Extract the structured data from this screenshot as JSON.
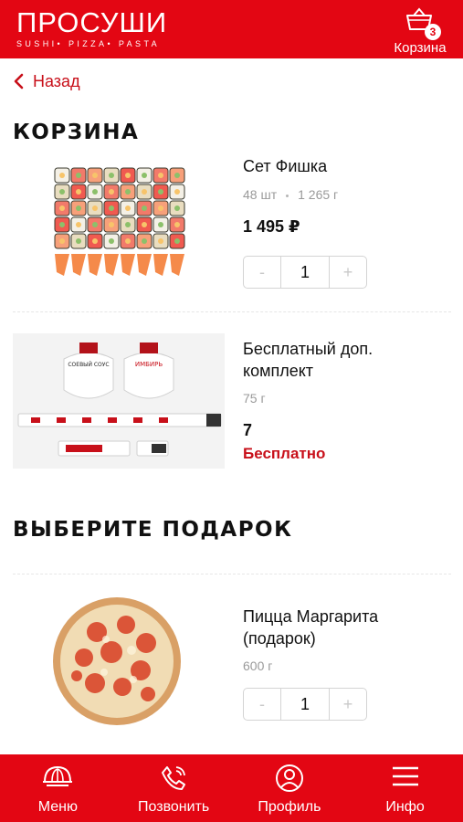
{
  "header": {
    "logo_title": "ПРОСУШИ",
    "logo_subtitle": "SUSHI• PIZZA• PASTA",
    "cart_count": "3",
    "cart_label": "Корзина",
    "cart_icon": "basket-icon"
  },
  "back_label": "Назад",
  "cart_title": "КОРЗИНА",
  "cart_items": [
    {
      "name": "Сет Фишка",
      "qty_pieces": "48 шт",
      "weight": "1 265 г",
      "price": "1 495 ₽",
      "quantity": "1",
      "minus": "-",
      "plus": "+"
    },
    {
      "name": "Бесплатный доп. комплект",
      "weight": "75 г",
      "quantity": "7",
      "price_label": "Бесплатно",
      "sauce_labels": [
        "СОЕВЫЙ СОУС",
        "ИМБИРЬ"
      ]
    }
  ],
  "gift_title": "ВЫБЕРИТЕ ПОДАРОК",
  "gift_items": [
    {
      "name": "Пицца Маргарита (подарок)",
      "weight": "600 г",
      "quantity": "1",
      "minus": "-",
      "plus": "+"
    }
  ],
  "bottom_nav": [
    {
      "label": "Меню",
      "icon": "menu-dome-icon"
    },
    {
      "label": "Позвонить",
      "icon": "phone-icon"
    },
    {
      "label": "Профиль",
      "icon": "profile-icon"
    },
    {
      "label": "Инфо",
      "icon": "hamburger-icon"
    }
  ],
  "colors": {
    "brand": "#e30613",
    "accent_text": "#c8101a",
    "muted": "#9a9a9a"
  }
}
